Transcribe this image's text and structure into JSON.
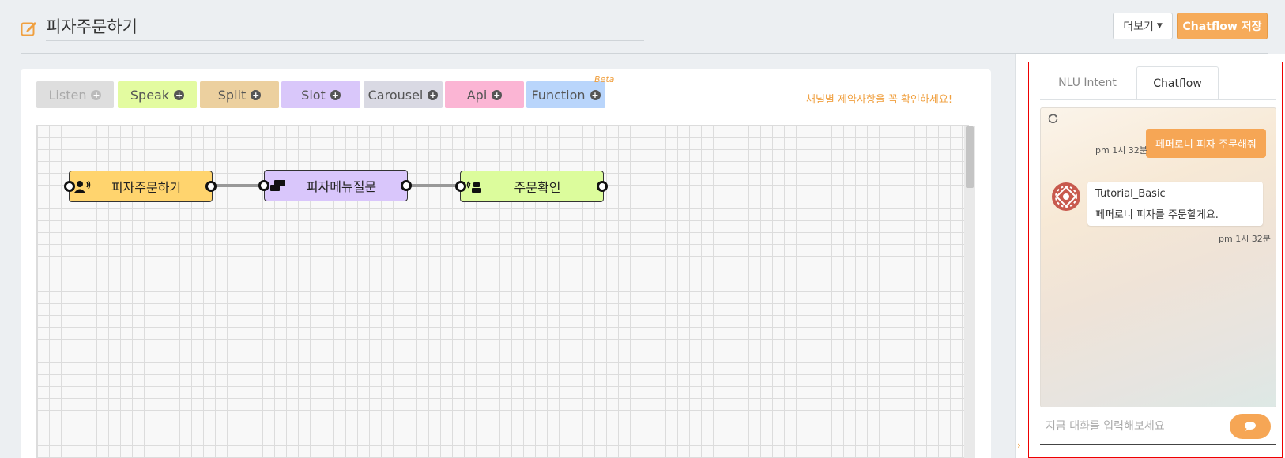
{
  "header": {
    "title": "피자주문하기",
    "more_label": "더보기",
    "save_label": "Chatflow 저장"
  },
  "palette": {
    "items": [
      {
        "label": "Listen",
        "color": "#dedede",
        "enabled": false
      },
      {
        "label": "Speak",
        "color": "#e3fba0"
      },
      {
        "label": "Split",
        "color": "#ecd09f"
      },
      {
        "label": "Slot",
        "color": "#d9c7fa"
      },
      {
        "label": "Carousel",
        "color": "#d9d9e3"
      },
      {
        "label": "Api",
        "color": "#fbb5d4"
      },
      {
        "label": "Function",
        "color": "#b9d5fb"
      }
    ],
    "beta_label": "Beta",
    "notice": "채널별 제약사항을 꼭 확인하세요!"
  },
  "flow": {
    "nodes": [
      {
        "label": "피자주문하기",
        "type": "speak-user",
        "color": "#ffd46e",
        "icon": "user-speaking-icon"
      },
      {
        "label": "피자메뉴질문",
        "type": "slot",
        "color": "#d9c6fb",
        "icon": "slot-icon"
      },
      {
        "label": "주문확인",
        "type": "listen",
        "color": "#dcfc9c",
        "icon": "bot-listening-icon"
      }
    ]
  },
  "chat": {
    "tabs": [
      {
        "label": "NLU Intent",
        "active": false
      },
      {
        "label": "Chatflow",
        "active": true
      }
    ],
    "messages": [
      {
        "from": "user",
        "text": "페퍼로니 피자 주문해줘",
        "time": "pm 1시 32분"
      },
      {
        "from": "bot",
        "name": "Tutorial_Basic",
        "text": "페퍼로니 피자를 주문할게요.",
        "time": "pm 1시 32분"
      }
    ],
    "input_placeholder": "지금 대화를 입력해보세요"
  },
  "colors": {
    "accent": "#f6ab5a",
    "highlight_frame": "#ee0000"
  }
}
